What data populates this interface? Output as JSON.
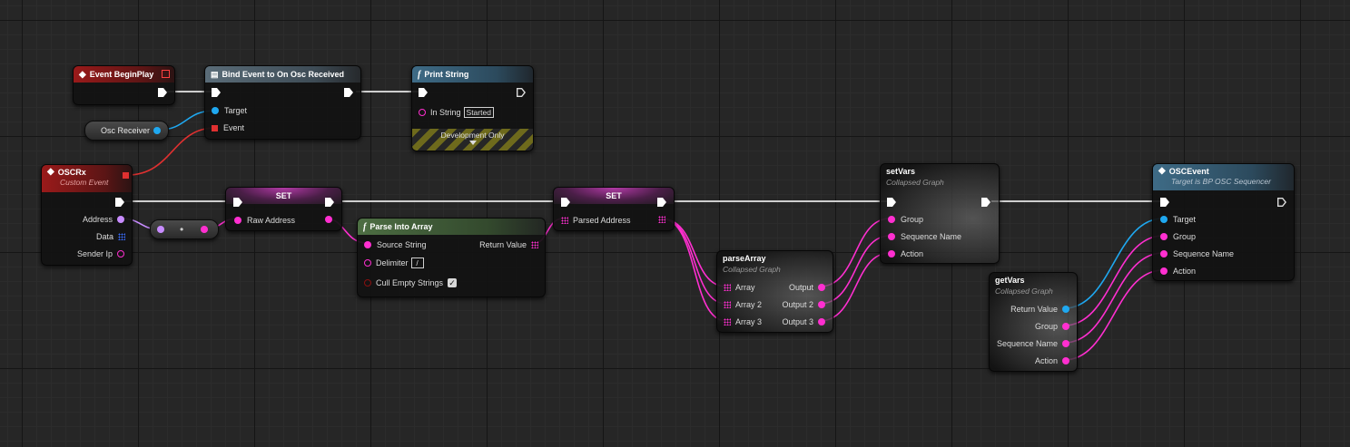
{
  "nodes": {
    "event_begin_play": {
      "title": "Event BeginPlay"
    },
    "bind_event": {
      "title": "Bind Event to On Osc Received",
      "target_label": "Target",
      "event_label": "Event"
    },
    "print_string": {
      "title": "Print String",
      "in_string_label": "In String",
      "in_string_value": "Started",
      "dev_label": "Development Only"
    },
    "osc_receiver": {
      "label": "Osc Receiver"
    },
    "oscrx": {
      "title": "OSCRx",
      "subtitle": "Custom Event",
      "address": "Address",
      "data": "Data",
      "sender_ip": "Sender Ip"
    },
    "set1": {
      "title": "SET",
      "raw_address": "Raw Address"
    },
    "parse_into_array": {
      "title": "Parse Into Array",
      "source_string": "Source String",
      "return_value": "Return Value",
      "delimiter": "Delimiter",
      "delimiter_value": "/",
      "cull_empty": "Cull Empty Strings"
    },
    "set2": {
      "title": "SET",
      "parsed_address": "Parsed Address"
    },
    "parse_array": {
      "title": "parseArray",
      "subtitle": "Collapsed Graph",
      "array": "Array",
      "array2": "Array 2",
      "array3": "Array 3",
      "output": "Output",
      "output2": "Output 2",
      "output3": "Output 3"
    },
    "set_vars": {
      "title": "setVars",
      "subtitle": "Collapsed Graph",
      "group": "Group",
      "sequence_name": "Sequence Name",
      "action": "Action"
    },
    "get_vars": {
      "title": "getVars",
      "subtitle": "Collapsed Graph",
      "return_value": "Return Value",
      "group": "Group",
      "sequence_name": "Sequence Name",
      "action": "Action"
    },
    "osc_event": {
      "title": "OSCEvent",
      "subtitle": "Target is BP OSC Sequencer",
      "target": "Target",
      "group": "Group",
      "sequence_name": "Sequence Name",
      "action": "Action"
    }
  },
  "colors": {
    "exec": "#ffffff",
    "string": "#ff2fd0",
    "object": "#1fa8f0",
    "delegate": "#e03030",
    "name": "#c88cff"
  }
}
